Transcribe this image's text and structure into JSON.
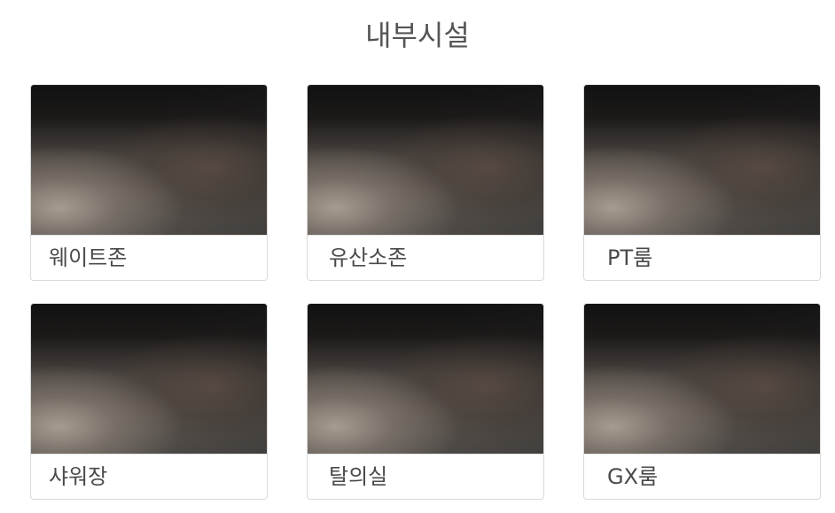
{
  "section": {
    "title": "내부시설"
  },
  "facilities": [
    {
      "label": "웨이트존"
    },
    {
      "label": "유산소존"
    },
    {
      "label": "PT룸"
    },
    {
      "label": "샤워장"
    },
    {
      "label": "탈의실"
    },
    {
      "label": "GX룸"
    }
  ]
}
